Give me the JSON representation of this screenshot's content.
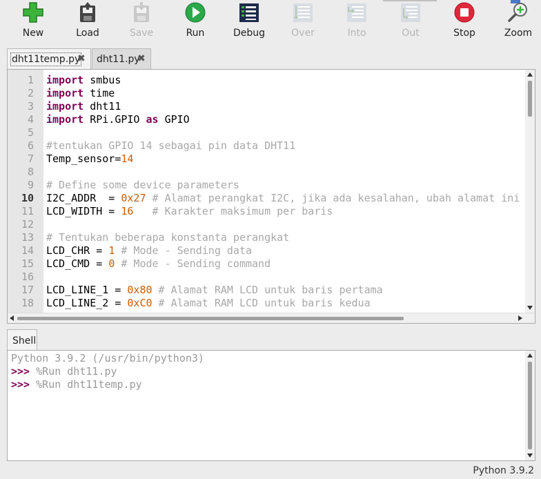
{
  "toolbar": {
    "new": "New",
    "load": "Load",
    "save": "Save",
    "run": "Run",
    "debug": "Debug",
    "over": "Over",
    "into": "Into",
    "out": "Out",
    "stop": "Stop",
    "zoom": "Zoom"
  },
  "editor_tabs": [
    {
      "label": "dht11temp.py",
      "close": "✖",
      "active": true
    },
    {
      "label": "dht11.py",
      "close": "✖",
      "active": false
    }
  ],
  "editor": {
    "current_line": 10,
    "line_numbers": [
      "1",
      "2",
      "3",
      "4",
      "5",
      "6",
      "7",
      "8",
      "9",
      "10",
      "11",
      "12",
      "13",
      "14",
      "15",
      "16",
      "17",
      "18"
    ]
  },
  "code": {
    "l1_kw": "import",
    "l1_rest": " smbus",
    "l2_kw": "import",
    "l2_rest": " time",
    "l3_kw": "import",
    "l3_rest": " dht11",
    "l4_kw": "import",
    "l4_mid": " RPi.GPIO ",
    "l4_kw2": "as",
    "l4_rest": " GPIO",
    "l6_cm": "#tentukan GPIO 14 sebagai pin data DHT11",
    "l7_a": "Temp_sensor=",
    "l7_num": "14",
    "l9_cm": "# Define some device parameters",
    "l10_a": "I2C_ADDR  = ",
    "l10_num": "0x27",
    "l10_cm": " # Alamat perangkat I2C, jika ada kesalahan, ubah alamat ini",
    "l11_a": "LCD_WIDTH = ",
    "l11_num": "16",
    "l11_cm": "   # Karakter maksimum per baris",
    "l13_cm": "# Tentukan beberapa konstanta perangkat",
    "l14_a": "LCD_CHR = ",
    "l14_num": "1",
    "l14_cm": " # Mode - Sending data",
    "l15_a": "LCD_CMD = ",
    "l15_num": "0",
    "l15_cm": " # Mode - Sending command",
    "l17_a": "LCD_LINE_1 = ",
    "l17_num": "0x80",
    "l17_cm": " # Alamat RAM LCD untuk baris pertama",
    "l18_a": "LCD_LINE_2 = ",
    "l18_num": "0xC0",
    "l18_cm": " # Alamat RAM LCD untuk baris kedua"
  },
  "shell": {
    "tab_label": "Shell",
    "info": "Python 3.9.2 (/usr/bin/python3)",
    "prompt": ">>>",
    "cmd1": " %Run dht11.py",
    "cmd2": " %Run dht11temp.py"
  },
  "status": "Python 3.9.2",
  "icons": [
    "new-icon",
    "load-icon",
    "save-icon",
    "run-icon",
    "debug-icon",
    "step-over-icon",
    "step-into-icon",
    "step-out-icon",
    "stop-icon",
    "zoom-icon"
  ],
  "colors": {
    "keyword": "#7f0055",
    "number": "#c65d09",
    "comment": "#a8a8a8",
    "run": "#2aa84a",
    "stop": "#e0283c"
  }
}
